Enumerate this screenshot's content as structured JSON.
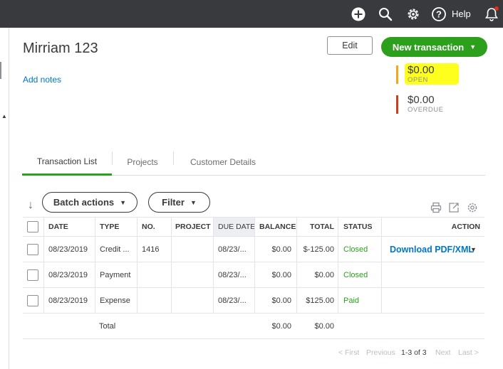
{
  "topbar": {
    "icons": [
      "plus-circle-icon",
      "search-icon",
      "gear-icon",
      "help-icon",
      "bell-icon"
    ],
    "help_label": "Help"
  },
  "customer": {
    "name": "Mirriam 123",
    "add_notes": "Add notes"
  },
  "buttons": {
    "edit": "Edit",
    "new_transaction": "New transaction"
  },
  "summary": {
    "open_amount": "$0.00",
    "open_label": "OPEN",
    "overdue_amount": "$0.00",
    "overdue_label": "OVERDUE"
  },
  "colors": {
    "green": "#2ca01c",
    "open_bar": "#f2a81d",
    "overdue_bar": "#c9401e",
    "highlight": "#ffff1e",
    "link": "#0077c5"
  },
  "tabs": [
    "Transaction List",
    "Projects",
    "Customer Details"
  ],
  "toolbar": {
    "batch_actions": "Batch actions",
    "filter": "Filter"
  },
  "table": {
    "headers": {
      "date": "DATE",
      "type": "TYPE",
      "no": "NO.",
      "project": "PROJECT",
      "due_date": "DUE DATE",
      "balance": "BALANCE",
      "total": "TOTAL",
      "status": "STATUS",
      "action": "ACTION"
    },
    "rows": [
      {
        "date": "08/23/2019",
        "type": "Credit ...",
        "no": "1416",
        "project": "",
        "due_date": "08/23/...",
        "balance": "$0.00",
        "total": "$-125.00",
        "status": "Closed",
        "action": "Download PDF/XML"
      },
      {
        "date": "08/23/2019",
        "type": "Payment",
        "no": "",
        "project": "",
        "due_date": "08/23/...",
        "balance": "$0.00",
        "total": "$0.00",
        "status": "Closed",
        "action": ""
      },
      {
        "date": "08/23/2019",
        "type": "Expense",
        "no": "",
        "project": "",
        "due_date": "08/23/...",
        "balance": "$0.00",
        "total": "$125.00",
        "status": "Paid",
        "action": ""
      }
    ],
    "totals": {
      "label": "Total",
      "balance": "$0.00",
      "total": "$0.00"
    }
  },
  "pagination": {
    "first": "< First",
    "previous": "Previous",
    "range": "1-3 of 3",
    "next": "Next",
    "last": "Last >"
  }
}
